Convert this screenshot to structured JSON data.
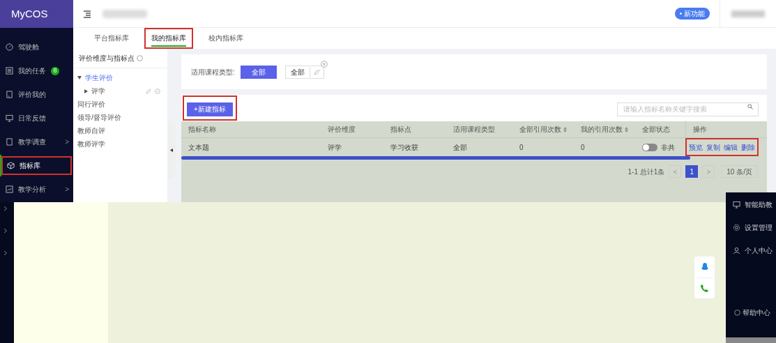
{
  "sidebar": {
    "logo": "MyCOS",
    "items": [
      {
        "label": "驾驶舱",
        "selected": false,
        "highlighted": false
      },
      {
        "label": "我的任务",
        "badge": "8",
        "selected": false,
        "highlighted": false
      },
      {
        "label": "评价我的",
        "selected": false,
        "highlighted": false
      },
      {
        "label": "日常反馈",
        "selected": false,
        "highlighted": false
      },
      {
        "label": "教学调查",
        "arrow": ">",
        "selected": false,
        "highlighted": false
      },
      {
        "label": "指标库",
        "selected": true,
        "highlighted": true
      },
      {
        "label": "教学分析",
        "arrow": ">",
        "selected": false,
        "highlighted": false
      }
    ]
  },
  "header": {
    "new_feature": "• 新功能"
  },
  "tabs": [
    {
      "label": "平台指标库",
      "selected": false,
      "highlighted": false
    },
    {
      "label": "我的指标库",
      "selected": true,
      "highlighted": true
    },
    {
      "label": "校内指标库",
      "selected": false,
      "highlighted": false
    }
  ],
  "tree_panel": {
    "title": "评价维度与指标点",
    "items": [
      {
        "label": "学生评价",
        "selected": true,
        "expanded": true,
        "children": [
          {
            "label": "评学",
            "expanded": false,
            "selected": false
          }
        ]
      },
      {
        "label": "同行评价",
        "selected": false
      },
      {
        "label": "领导/督导评价",
        "selected": false
      },
      {
        "label": "教师自评",
        "selected": false
      },
      {
        "label": "教师评学",
        "selected": false
      }
    ]
  },
  "filter": {
    "label": "适用课程类型:",
    "options": [
      {
        "label": "全部",
        "selected": true
      }
    ],
    "tag": "全部"
  },
  "new_button": {
    "label": "+新建指标",
    "highlighted": true
  },
  "search": {
    "placeholder": "请输入指标名称关键字搜索"
  },
  "table": {
    "columns": [
      {
        "label": "指标名称"
      },
      {
        "label": "评价维度"
      },
      {
        "label": "指标点"
      },
      {
        "label": "适用课程类型"
      },
      {
        "label": "全部引用次数",
        "sortable": true
      },
      {
        "label": "我的引用次数",
        "sortable": true
      },
      {
        "label": "全部状态"
      },
      {
        "label": "操作"
      }
    ],
    "rows": [
      {
        "cells": [
          "文本题",
          "评学",
          "学习收获",
          "全部",
          "0",
          "0"
        ],
        "shared": false,
        "status": "非共",
        "actions": [
          "预览",
          "复制",
          "编辑",
          "删除"
        ],
        "actions_highlighted": true
      }
    ]
  },
  "pagination": {
    "summary": "1-1 总计1条",
    "prev": "<",
    "pages": [
      {
        "label": "1",
        "selected": true
      }
    ],
    "next": ">",
    "page_size": "10 条/页"
  },
  "side_panel": {
    "items": [
      {
        "label": "智能助教"
      },
      {
        "label": "设置管理"
      },
      {
        "label": "个人中心"
      }
    ],
    "help": "帮助中心"
  }
}
